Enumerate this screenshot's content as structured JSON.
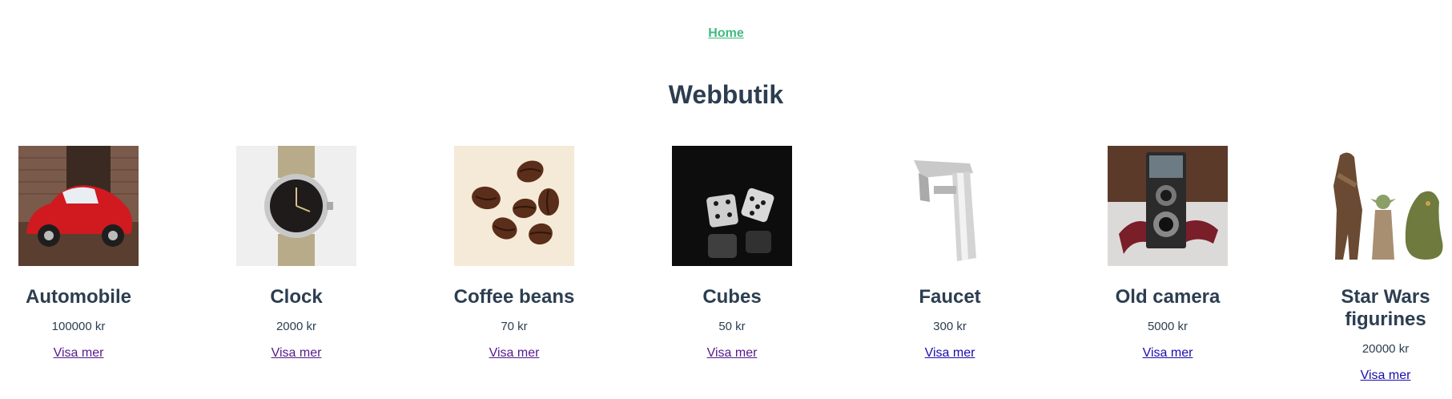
{
  "nav": {
    "home_label": "Home"
  },
  "page": {
    "title": "Webbutik"
  },
  "products": [
    {
      "name": "Automobile",
      "price": "100000 kr",
      "link_label": "Visa mer",
      "image_icon": "red-car-image"
    },
    {
      "name": "Clock",
      "price": "2000 kr",
      "link_label": "Visa mer",
      "image_icon": "wristwatch-image"
    },
    {
      "name": "Coffee beans",
      "price": "70 kr",
      "link_label": "Visa mer",
      "image_icon": "coffee-beans-image"
    },
    {
      "name": "Cubes",
      "price": "50 kr",
      "link_label": "Visa mer",
      "image_icon": "dice-image"
    },
    {
      "name": "Faucet",
      "price": "300 kr",
      "link_label": "Visa mer",
      "image_icon": "faucet-image"
    },
    {
      "name": "Old camera",
      "price": "5000 kr",
      "link_label": "Visa mer",
      "image_icon": "vintage-camera-image"
    },
    {
      "name": "Star Wars figurines",
      "price": "20000 kr",
      "link_label": "Visa mer",
      "image_icon": "figurines-image"
    }
  ],
  "colors": {
    "heading": "#2c3e50",
    "home_link": "#42b983",
    "visited_link": "#551a8b",
    "link": "#1a0dab"
  }
}
